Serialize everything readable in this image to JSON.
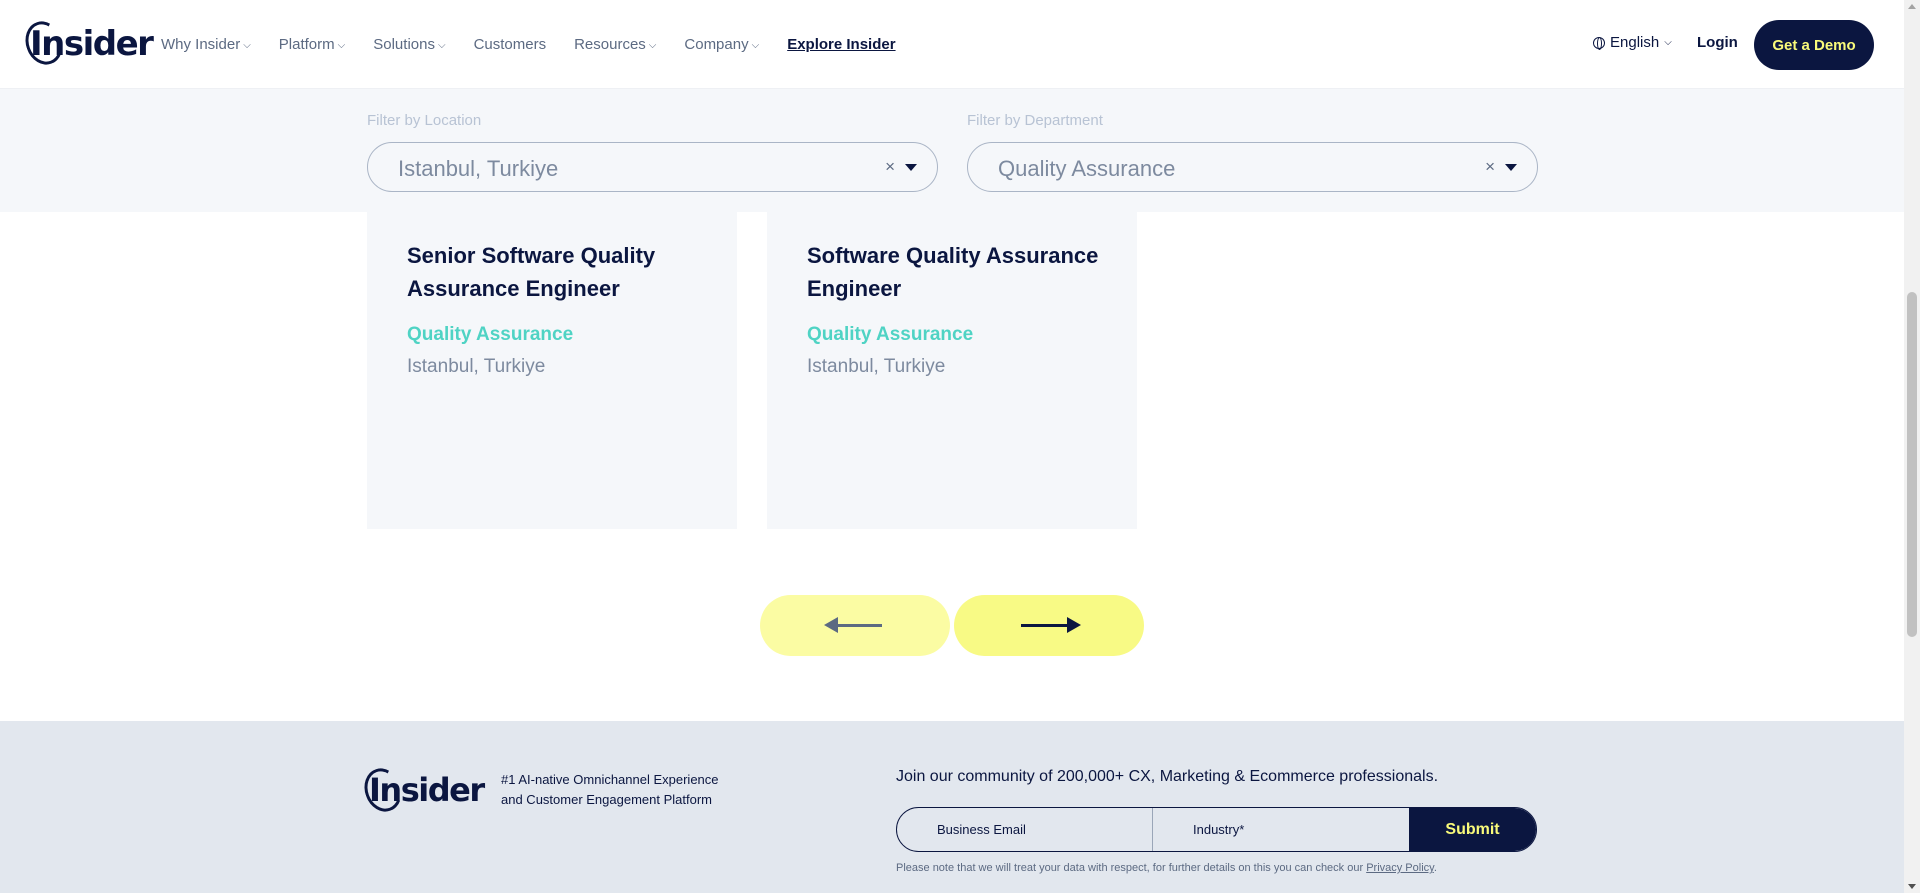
{
  "header": {
    "logo_text": "Insider",
    "nav": [
      {
        "label": "Why Insider",
        "dropdown": true
      },
      {
        "label": "Platform",
        "dropdown": true
      },
      {
        "label": "Solutions",
        "dropdown": true
      },
      {
        "label": "Customers",
        "dropdown": false
      },
      {
        "label": "Resources",
        "dropdown": true
      },
      {
        "label": "Company",
        "dropdown": true
      },
      {
        "label": "Explore Insider",
        "dropdown": false
      }
    ],
    "language": "English",
    "login": "Login",
    "cta": "Get a Demo"
  },
  "filters": {
    "location": {
      "label": "Filter by Location",
      "value": "Istanbul, Turkiye",
      "clear": "×"
    },
    "department": {
      "label": "Filter by Department",
      "value": "Quality Assurance",
      "clear": "×"
    }
  },
  "jobs": [
    {
      "title": "Senior Software Quality Assurance Engineer",
      "department": "Quality Assurance",
      "location": "Istanbul, Turkiye"
    },
    {
      "title": "Software Quality Assurance Engineer",
      "department": "Quality Assurance",
      "location": "Istanbul, Turkiye"
    }
  ],
  "carousel": {
    "prev_icon": "arrow-left-icon",
    "next_icon": "arrow-right-icon"
  },
  "footer": {
    "logo_text": "Insider",
    "tagline": "#1 AI-native Omnichannel Experience and Customer Engagement Platform",
    "join_text": "Join our community of 200,000+ CX, Marketing & Ecommerce professionals.",
    "email_placeholder": "Business Email",
    "industry_placeholder": "Industry*",
    "submit": "Submit",
    "note": "Please note that we will treat your data with respect, for further details on this you can check our ",
    "privacy_link": "Privacy Policy",
    "note_end": "."
  },
  "colors": {
    "navy": "#0b1640",
    "accent_yellow": "#f9fa7a",
    "teal": "#4fd3c4",
    "card_bg": "#f5f7fa",
    "footer_bg": "#e2e7ee"
  }
}
